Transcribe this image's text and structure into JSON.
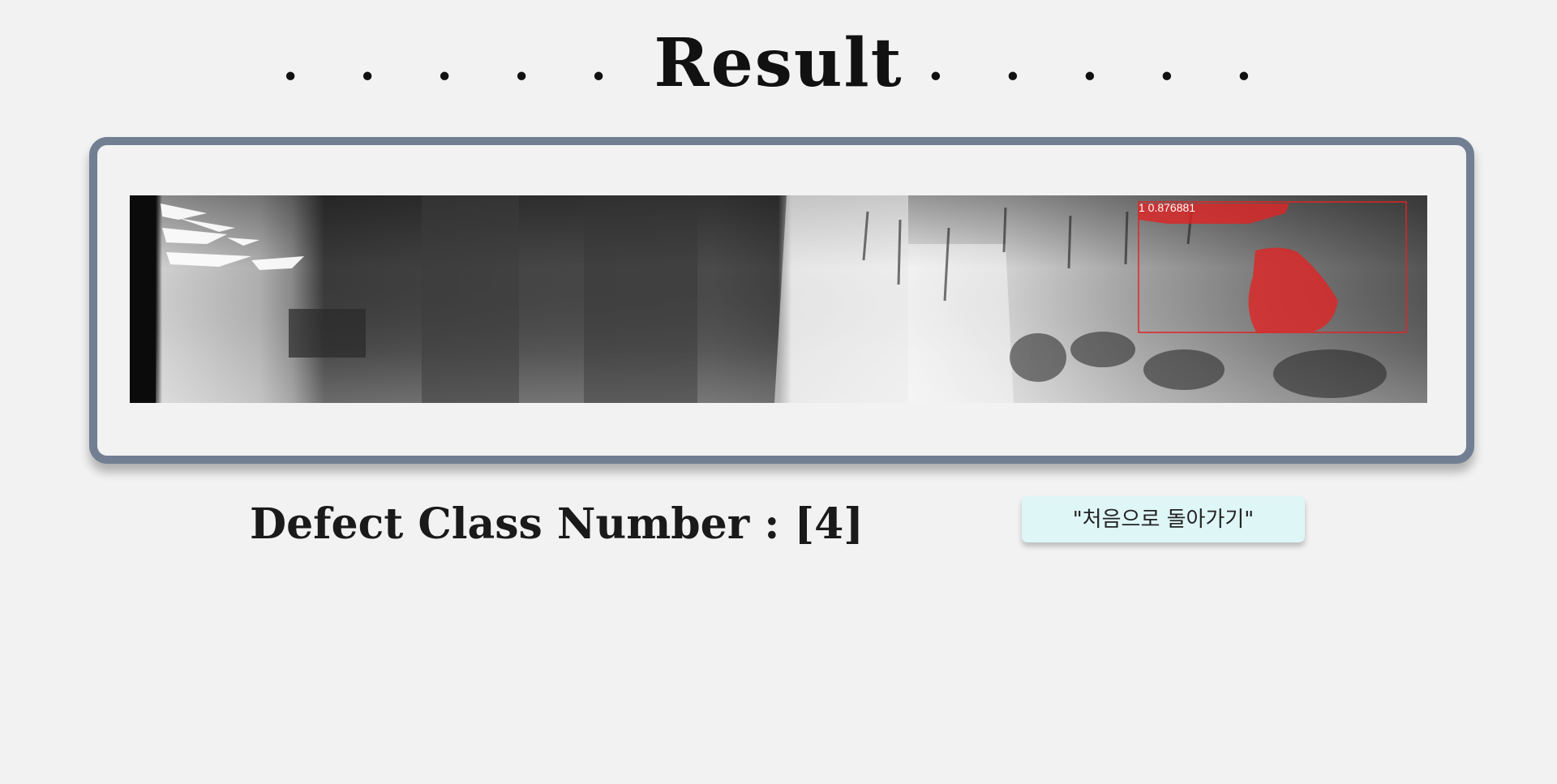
{
  "header": {
    "title": "Result",
    "left_dots": ". . . . .",
    "right_dots": ". . . . ."
  },
  "result_image": {
    "detection_label": "1 0.876881"
  },
  "result": {
    "defect_text": "Defect Class Number : [4]"
  },
  "actions": {
    "home_button_label": "\"처음으로 돌아가기\""
  },
  "colors": {
    "background": "#f2f2f2",
    "panel_border": "#727f93",
    "button_background": "#dff6f7",
    "detection_color": "#e02424"
  }
}
